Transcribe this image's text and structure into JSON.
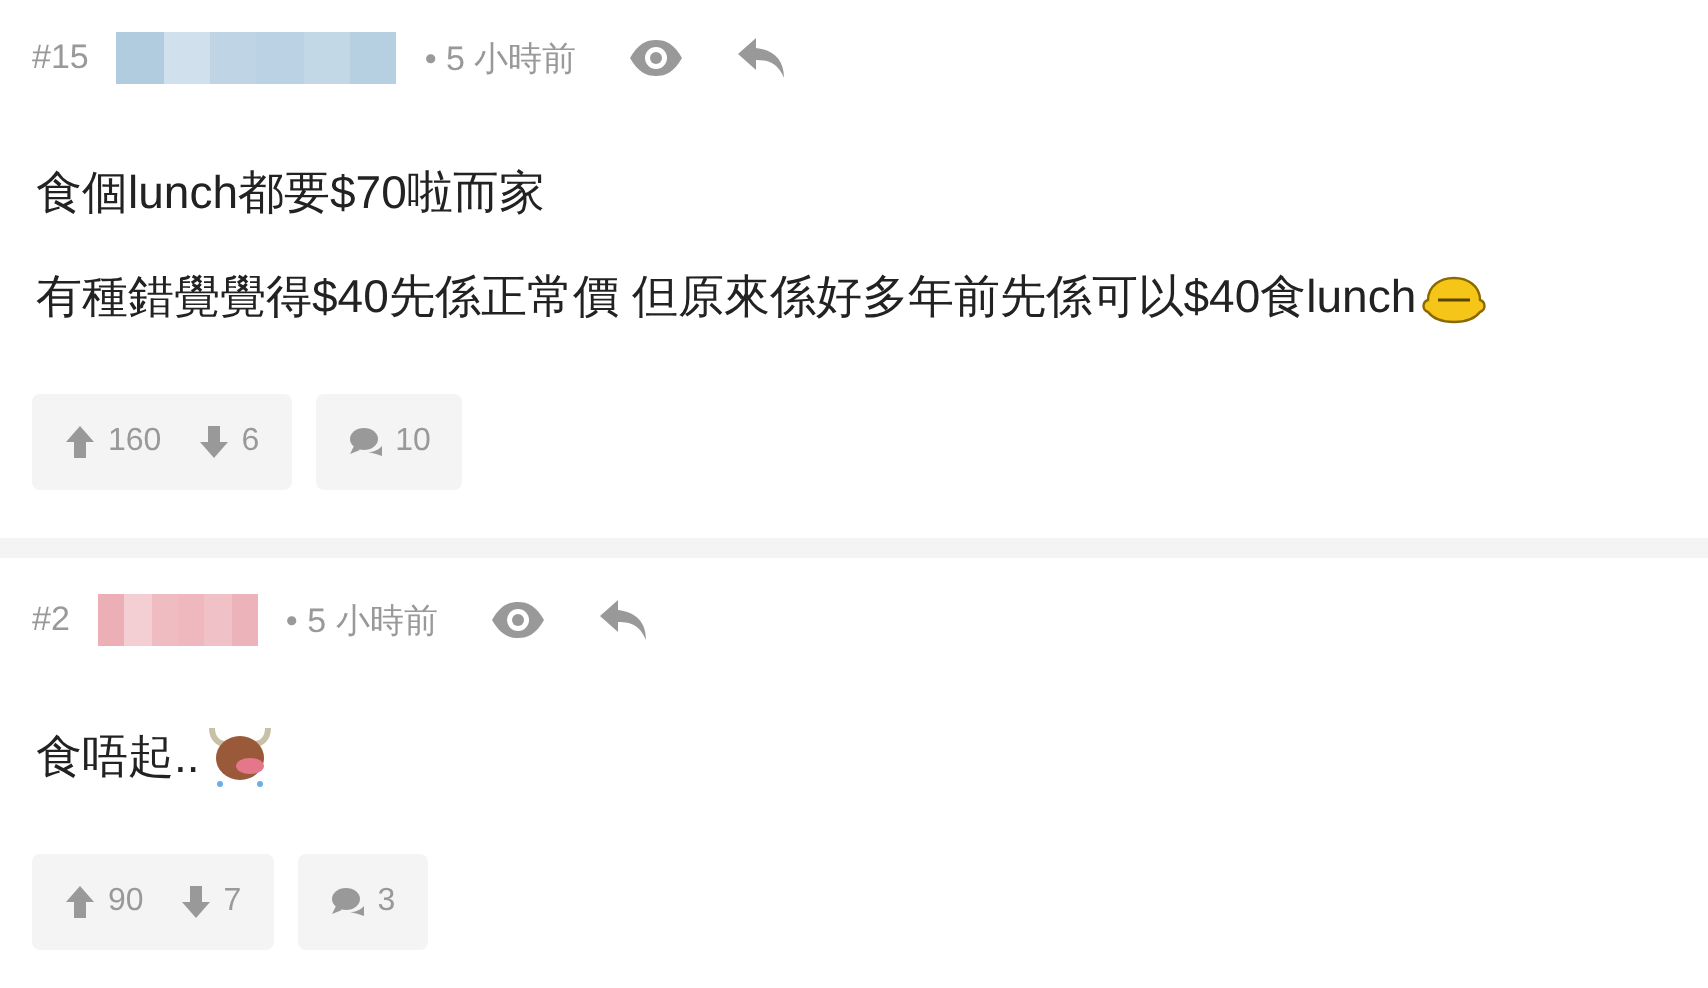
{
  "posts": [
    {
      "number": "#15",
      "color": "#a9c7dc",
      "time": "• 5 小時前",
      "lines": [
        {
          "text": "食個lunch都要$70啦而家"
        },
        {
          "text": "有種錯覺覺得$40先係正常價 但原來係好多年前先係可以$40食lunch",
          "kind": "duck"
        }
      ],
      "upvotes": "160",
      "downvotes": "6",
      "replies": "10"
    },
    {
      "number": "#2",
      "color": "#eaa6ae",
      "time": "• 5 小時前",
      "lines": [
        {
          "text": "食唔起..",
          "kind": "bull"
        }
      ],
      "upvotes": "90",
      "downvotes": "7",
      "replies": "3"
    }
  ]
}
